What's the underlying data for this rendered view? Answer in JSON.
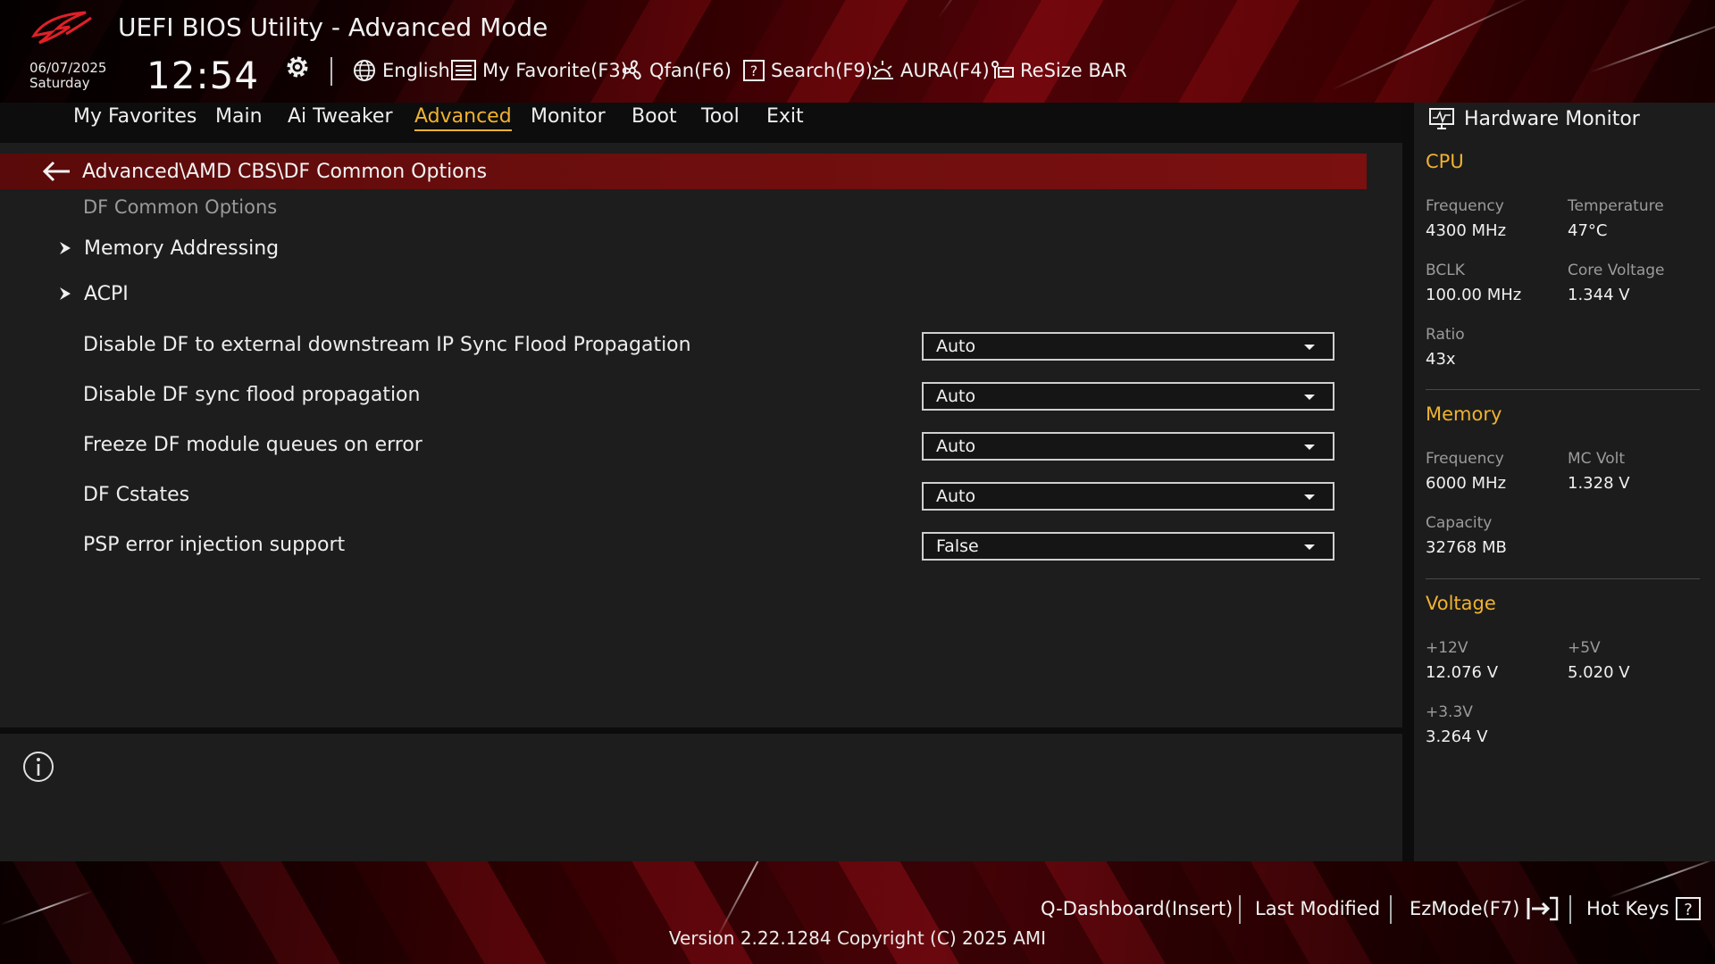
{
  "header": {
    "title": "UEFI BIOS Utility - Advanced Mode",
    "date": "06/07/2025",
    "day": "Saturday",
    "time": "12:54",
    "toolbar": [
      {
        "label": "English",
        "icon": "globe-icon"
      },
      {
        "label": "My Favorite(F3)",
        "icon": "favorite-list-icon"
      },
      {
        "label": "Qfan(F6)",
        "icon": "fan-icon"
      },
      {
        "label": "Search(F9)",
        "icon": "search-help-icon"
      },
      {
        "label": "AURA(F4)",
        "icon": "aura-icon"
      },
      {
        "label": "ReSize BAR",
        "icon": "resize-bar-icon"
      }
    ]
  },
  "nav": {
    "tabs": [
      {
        "label": "My Favorites"
      },
      {
        "label": "Main"
      },
      {
        "label": "Ai Tweaker"
      },
      {
        "label": "Advanced",
        "active": true
      },
      {
        "label": "Monitor"
      },
      {
        "label": "Boot"
      },
      {
        "label": "Tool"
      },
      {
        "label": "Exit"
      }
    ]
  },
  "main": {
    "breadcrumb": "Advanced\\AMD CBS\\DF Common Options",
    "section_title": "DF Common Options",
    "submenus": [
      {
        "label": "Memory Addressing"
      },
      {
        "label": "ACPI"
      }
    ],
    "settings": [
      {
        "label": "Disable DF to external downstream IP Sync Flood Propagation",
        "value": "Auto"
      },
      {
        "label": "Disable DF sync flood propagation",
        "value": "Auto"
      },
      {
        "label": "Freeze DF module queues on error",
        "value": "Auto"
      },
      {
        "label": "DF Cstates",
        "value": "Auto"
      },
      {
        "label": "PSP error injection support",
        "value": "False"
      }
    ]
  },
  "hardware_monitor": {
    "title": "Hardware Monitor",
    "cpu": {
      "section": "CPU",
      "frequency_label": "Frequency",
      "frequency": "4300 MHz",
      "temperature_label": "Temperature",
      "temperature": "47°C",
      "bclk_label": "BCLK",
      "bclk": "100.00 MHz",
      "core_voltage_label": "Core Voltage",
      "core_voltage": "1.344 V",
      "ratio_label": "Ratio",
      "ratio": "43x"
    },
    "memory": {
      "section": "Memory",
      "frequency_label": "Frequency",
      "frequency": "6000 MHz",
      "mc_volt_label": "MC Volt",
      "mc_volt": "1.328 V",
      "capacity_label": "Capacity",
      "capacity": "32768 MB"
    },
    "voltage": {
      "section": "Voltage",
      "v12_label": "+12V",
      "v12": "12.076 V",
      "v5_label": "+5V",
      "v5": "5.020 V",
      "v33_label": "+3.3V",
      "v33": "3.264 V"
    }
  },
  "footer": {
    "q_dashboard": "Q-Dashboard(Insert)",
    "last_modified": "Last Modified",
    "ezmode": "EzMode(F7)",
    "hot_keys": "Hot Keys",
    "version": "Version 2.22.1284 Copyright (C) 2025 AMI"
  },
  "colors": {
    "accent": "#f0b230",
    "breadcrumb_bg": "#6e0e0e",
    "panel_bg": "#1d1d1d"
  }
}
